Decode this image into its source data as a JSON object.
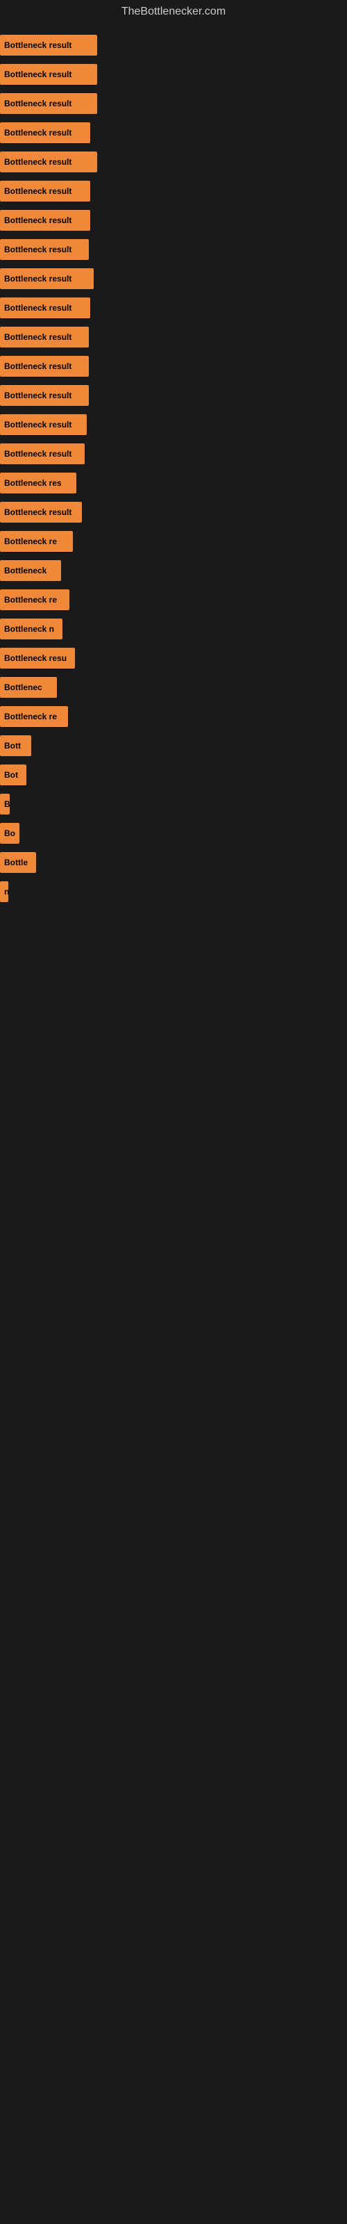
{
  "site": {
    "title": "TheBottlenecker.com"
  },
  "bars": [
    {
      "label": "Bottleneck result",
      "width": 140
    },
    {
      "label": "Bottleneck result",
      "width": 140
    },
    {
      "label": "Bottleneck result",
      "width": 140
    },
    {
      "label": "Bottleneck result",
      "width": 130
    },
    {
      "label": "Bottleneck result",
      "width": 140
    },
    {
      "label": "Bottleneck result",
      "width": 130
    },
    {
      "label": "Bottleneck result",
      "width": 130
    },
    {
      "label": "Bottleneck result",
      "width": 128
    },
    {
      "label": "Bottleneck result",
      "width": 135
    },
    {
      "label": "Bottleneck result",
      "width": 130
    },
    {
      "label": "Bottleneck result",
      "width": 128
    },
    {
      "label": "Bottleneck result",
      "width": 128
    },
    {
      "label": "Bottleneck result",
      "width": 128
    },
    {
      "label": "Bottleneck result",
      "width": 125
    },
    {
      "label": "Bottleneck result",
      "width": 122
    },
    {
      "label": "Bottleneck res",
      "width": 110
    },
    {
      "label": "Bottleneck result",
      "width": 118
    },
    {
      "label": "Bottleneck re",
      "width": 105
    },
    {
      "label": "Bottleneck",
      "width": 88
    },
    {
      "label": "Bottleneck re",
      "width": 100
    },
    {
      "label": "Bottleneck n",
      "width": 90
    },
    {
      "label": "Bottleneck resu",
      "width": 108
    },
    {
      "label": "Bottlenec",
      "width": 82
    },
    {
      "label": "Bottleneck re",
      "width": 98
    },
    {
      "label": "Bott",
      "width": 45
    },
    {
      "label": "Bot",
      "width": 38
    },
    {
      "label": "B",
      "width": 14
    },
    {
      "label": "Bo",
      "width": 28
    },
    {
      "label": "Bottle",
      "width": 52
    },
    {
      "label": "n",
      "width": 12
    }
  ]
}
